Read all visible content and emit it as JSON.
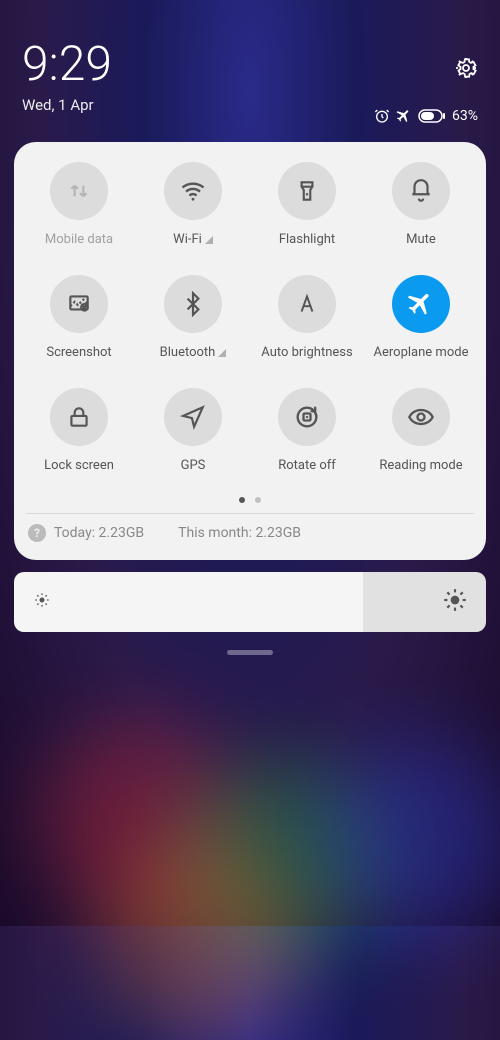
{
  "status": {
    "time": "9:29",
    "date": "Wed, 1 Apr",
    "battery_percent": "63%"
  },
  "tiles": {
    "mobile_data": "Mobile data",
    "wifi": "Wi-Fi",
    "flashlight": "Flashlight",
    "mute": "Mute",
    "screenshot": "Screenshot",
    "bluetooth": "Bluetooth",
    "auto_brightness": "Auto brightness",
    "aeroplane": "Aeroplane mode",
    "lock_screen": "Lock screen",
    "gps": "GPS",
    "rotate_off": "Rotate off",
    "reading_mode": "Reading mode"
  },
  "usage": {
    "today": "Today: 2.23GB",
    "month": "This month: 2.23GB"
  },
  "brightness": {
    "level_percent": 74
  }
}
